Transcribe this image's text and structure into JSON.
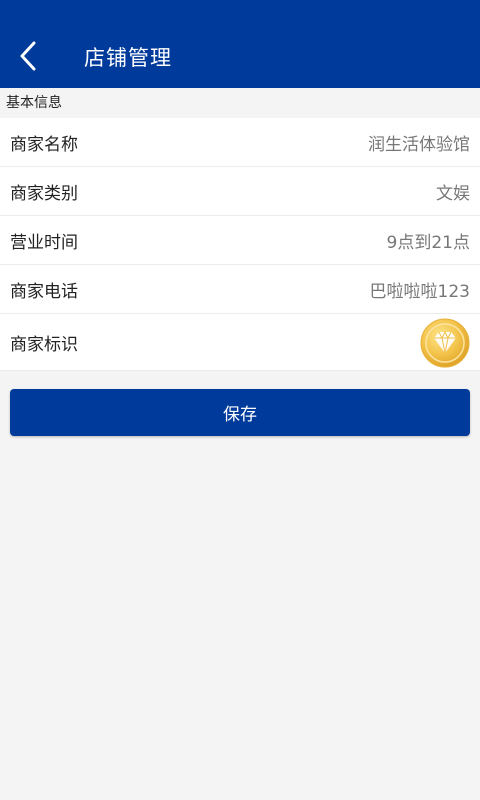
{
  "header": {
    "title": "店铺管理",
    "back_icon": "chevron-left-icon"
  },
  "section": {
    "title": "基本信息"
  },
  "rows": [
    {
      "label": "商家名称",
      "value": "润生活体验馆"
    },
    {
      "label": "商家类别",
      "value": "文娱"
    },
    {
      "label": "营业时间",
      "value": "9点到21点"
    },
    {
      "label": "商家电话",
      "value": "巴啦啦啦123"
    },
    {
      "label": "商家标识",
      "icon": "diamond-badge-icon"
    }
  ],
  "actions": {
    "save_label": "保存"
  },
  "colors": {
    "primary": "#003a9b",
    "background": "#f4f4f4",
    "badge_gold": "#f3c34a"
  }
}
